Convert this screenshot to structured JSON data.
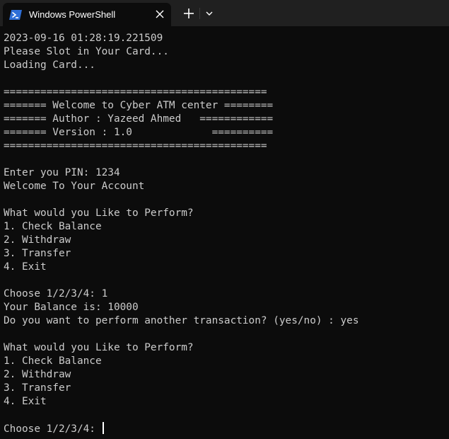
{
  "window": {
    "tab_title": "Windows PowerShell",
    "tab_icon": "powershell-icon",
    "close_icon": "close-icon",
    "new_tab_icon": "plus-icon",
    "dropdown_icon": "chevron-down-icon"
  },
  "colors": {
    "background": "#0c0c0c",
    "titlebar": "#202020",
    "text": "#cccccc",
    "powershell_blue": "#2e6fd8"
  },
  "terminal": {
    "lines": [
      "2023-09-16 01:28:19.221509",
      "Please Slot in Your Card...",
      "Loading Card...",
      "",
      "===========================================",
      "======= Welcome to Cyber ATM center ========",
      "======= Author : Yazeed Ahmed   ============",
      "======= Version : 1.0             ==========",
      "===========================================",
      "",
      "Enter you PIN: 1234",
      "Welcome To Your Account",
      "",
      "What would you Like to Perform?",
      "1. Check Balance",
      "2. Withdraw",
      "3. Transfer",
      "4. Exit",
      "",
      "Choose 1/2/3/4: 1",
      "Your Balance is: 10000",
      "Do you want to perform another transaction? (yes/no) : yes",
      "",
      "What would you Like to Perform?",
      "1. Check Balance",
      "2. Withdraw",
      "3. Transfer",
      "4. Exit",
      "",
      "Choose 1/2/3/4: "
    ]
  }
}
